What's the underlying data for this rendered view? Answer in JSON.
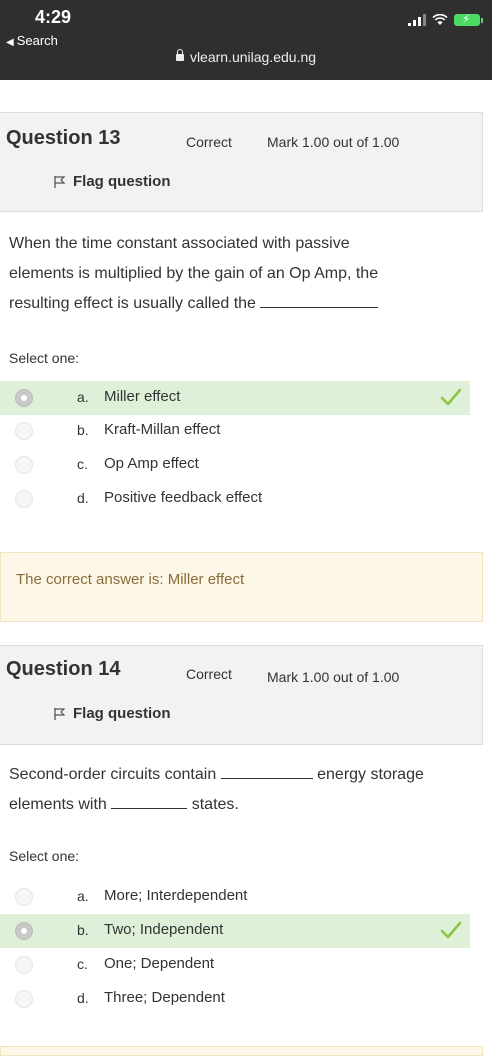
{
  "status_bar": {
    "time": "4:29",
    "back_label": "Search",
    "url": "vlearn.unilag.edu.ng"
  },
  "questions": [
    {
      "number": "Question 13",
      "state": "Correct",
      "mark": "Mark 1.00 out of 1.00",
      "flag_label": "Flag question",
      "text_lines": [
        "When the time constant associated with passive",
        "elements is multiplied by the gain of an Op Amp, the",
        "resulting effect is usually called the"
      ],
      "select_label": "Select one:",
      "options": [
        {
          "letter": "a.",
          "text": "Miller effect",
          "selected": true,
          "correct": true
        },
        {
          "letter": "b.",
          "text": "Kraft-Millan effect",
          "selected": false,
          "correct": false
        },
        {
          "letter": "c.",
          "text": "Op Amp effect",
          "selected": false,
          "correct": false
        },
        {
          "letter": "d.",
          "text": "Positive feedback effect",
          "selected": false,
          "correct": false
        }
      ],
      "feedback": "The correct answer is: Miller effect"
    },
    {
      "number": "Question 14",
      "state": "Correct",
      "mark": "Mark 1.00 out of 1.00",
      "flag_label": "Flag question",
      "text_parts": [
        "Second-order circuits contain",
        "energy storage",
        "elements with",
        "states."
      ],
      "select_label": "Select one:",
      "options": [
        {
          "letter": "a.",
          "text": "More; Interdependent",
          "selected": false,
          "correct": false
        },
        {
          "letter": "b.",
          "text": "Two; Independent",
          "selected": true,
          "correct": true
        },
        {
          "letter": "c.",
          "text": "One; Dependent",
          "selected": false,
          "correct": false
        },
        {
          "letter": "d.",
          "text": "Three; Dependent",
          "selected": false,
          "correct": false
        }
      ]
    }
  ],
  "colors": {
    "correct_bg": "#dff0d8",
    "tick": "#8cc63f",
    "feedback_bg": "#fcf7e6",
    "feedback_text": "#8a6d3b"
  },
  "icons": [
    "flag-icon",
    "lock-icon",
    "checkmark-icon",
    "signal-icon",
    "wifi-icon",
    "battery-icon"
  ]
}
